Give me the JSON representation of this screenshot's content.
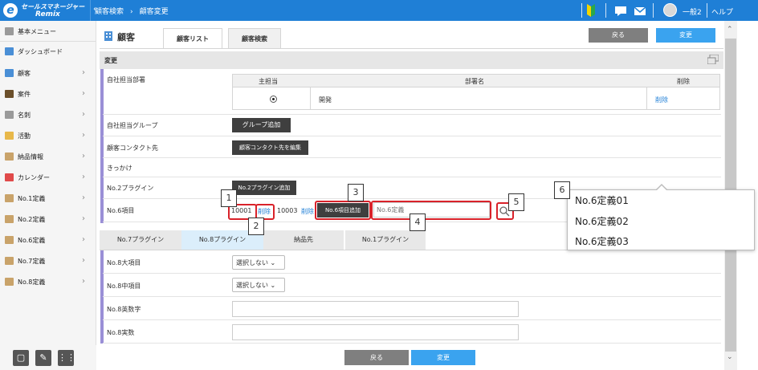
{
  "header": {
    "logo_top": "セールスマネージャー",
    "logo_bottom": "Remix",
    "breadcrumb": [
      "顧客検索",
      "顧客変更"
    ],
    "user": "一般2",
    "help": "ヘルプ"
  },
  "sidebar": {
    "items": [
      {
        "label": "基本メニュー",
        "icon": "grid-icon",
        "color": "#9a9a9a",
        "chev": false
      },
      {
        "label": "ダッシュボード",
        "icon": "dashboard-icon",
        "color": "#4a8fd6",
        "chev": false
      },
      {
        "label": "顧客",
        "icon": "building-icon",
        "color": "#4a8fd6",
        "chev": true
      },
      {
        "label": "案件",
        "icon": "folder-icon",
        "color": "#6b4f2a",
        "chev": true
      },
      {
        "label": "名刺",
        "icon": "card-icon",
        "color": "#9a9a9a",
        "chev": true
      },
      {
        "label": "活動",
        "icon": "memo-icon",
        "color": "#e8b84a",
        "chev": true
      },
      {
        "label": "納品情報",
        "icon": "delivery-icon",
        "color": "#c9a36a",
        "chev": true
      },
      {
        "label": "カレンダー",
        "icon": "calendar-icon",
        "color": "#e04a4a",
        "chev": true
      },
      {
        "label": "No.1定義",
        "icon": "definition-icon",
        "color": "#c9a36a",
        "chev": true
      },
      {
        "label": "No.2定義",
        "icon": "definition-icon",
        "color": "#c9a36a",
        "chev": true
      },
      {
        "label": "No.6定義",
        "icon": "definition-icon",
        "color": "#c9a36a",
        "chev": true
      },
      {
        "label": "No.7定義",
        "icon": "definition-icon",
        "color": "#c9a36a",
        "chev": true
      },
      {
        "label": "No.8定義",
        "icon": "definition-icon",
        "color": "#c9a36a",
        "chev": true
      }
    ]
  },
  "page": {
    "title": "顧客",
    "tabs": [
      "顧客リスト",
      "顧客検索"
    ],
    "back": "戻る",
    "change": "変更",
    "section": "変更"
  },
  "fields": {
    "dept_label": "自社担当部署",
    "dept_cols": [
      "主担当",
      "部署名",
      "削除"
    ],
    "dept_row": {
      "name": "開発",
      "delete": "削除"
    },
    "group_label": "自社担当グループ",
    "group_btn": "グループ追加",
    "contact_label": "顧客コンタクト先",
    "contact_btn": "顧客コンタクト先を編集",
    "trigger_label": "きっかけ",
    "no2_label": "No.2プラグイン",
    "no2_btn": "No.2プラグイン追加",
    "no6_label": "No.6項目",
    "no6_val1": "10001",
    "no6_del1": "削除",
    "no6_val2": "10003",
    "no6_del2": "削除",
    "no6_btn": "No.6項目追加",
    "no6_placeholder": "No.6定義"
  },
  "tabs2": [
    "No.7プラグイン",
    "No.8プラグイン",
    "納品先",
    "No.1プラグイン"
  ],
  "fields2": {
    "large": "No.8大項目",
    "mid": "No.8中項目",
    "alpha": "No.8英数字",
    "real": "No.8実数",
    "select_text": "選択しない"
  },
  "dropdown": [
    "No.6定義01",
    "No.6定義02",
    "No.6定義03"
  ],
  "callouts": [
    "1",
    "2",
    "3",
    "4",
    "5",
    "6"
  ],
  "footer": {
    "back": "戻る",
    "change": "変更"
  }
}
